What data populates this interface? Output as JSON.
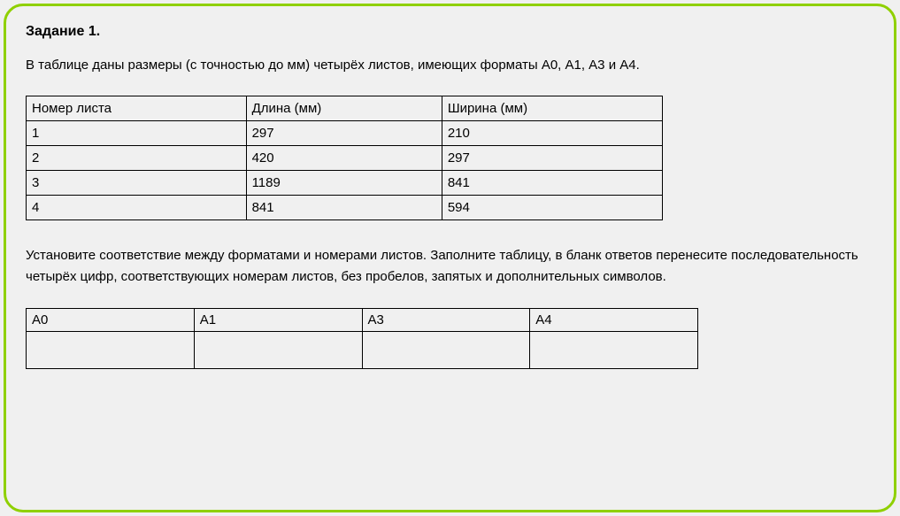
{
  "title": "Задание 1.",
  "intro": "В таблице даны размеры (с точностью до мм) четырёх листов, имеющих форматы А0, А1, А3 и А4.",
  "data_table": {
    "headers": [
      "Номер листа",
      "Длина (мм)",
      "Ширина (мм)"
    ],
    "rows": [
      [
        "1",
        "297",
        "210"
      ],
      [
        "2",
        "420",
        "297"
      ],
      [
        "3",
        "1189",
        "841"
      ],
      [
        "4",
        "841",
        "594"
      ]
    ]
  },
  "instructions": "Установите соответствие между форматами и номерами листов. Заполните таблицу, в бланк ответов перенесите последовательность четырёх цифр, соответствующих номерам листов, без пробелов, запятых и дополнительных символов.",
  "answer_table": {
    "headers": [
      "А0",
      "А1",
      "А3",
      "А4"
    ],
    "cells": [
      "",
      "",
      "",
      ""
    ]
  }
}
